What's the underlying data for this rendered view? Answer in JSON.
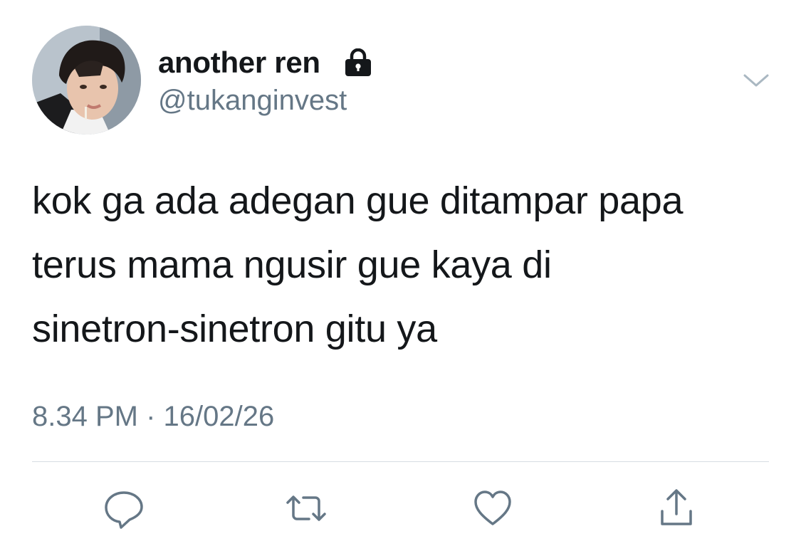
{
  "tweet": {
    "author": {
      "display_name": "another ren",
      "handle": "@tukanginvest",
      "protected_icon": "lock-icon"
    },
    "text_lines": [
      "kok ga ada adegan gue ditampar papa",
      "terus mama ngusir gue kaya di",
      "sinetron-sinetron gitu ya"
    ],
    "time": "8.34 PM",
    "separator": "·",
    "date": "16/02/26"
  },
  "actions": [
    {
      "icon": "reply-icon"
    },
    {
      "icon": "retweet-icon"
    },
    {
      "icon": "like-icon"
    },
    {
      "icon": "share-icon"
    }
  ],
  "menu": {
    "icon": "chevron-down-icon"
  },
  "colors": {
    "text": "#14171a",
    "secondary": "#657786",
    "divider": "#d7dde2",
    "background": "#ffffff"
  }
}
